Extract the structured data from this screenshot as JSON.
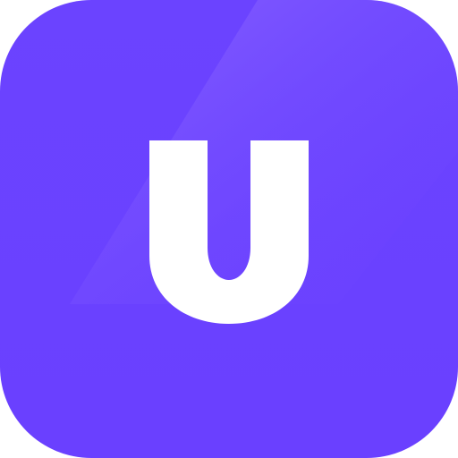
{
  "app_icon": {
    "name": "U",
    "glyph_name": "u-letter-icon",
    "colors": {
      "background": "#6a40ff",
      "highlight": "#8a63ff",
      "glyph": "#ffffff"
    }
  }
}
